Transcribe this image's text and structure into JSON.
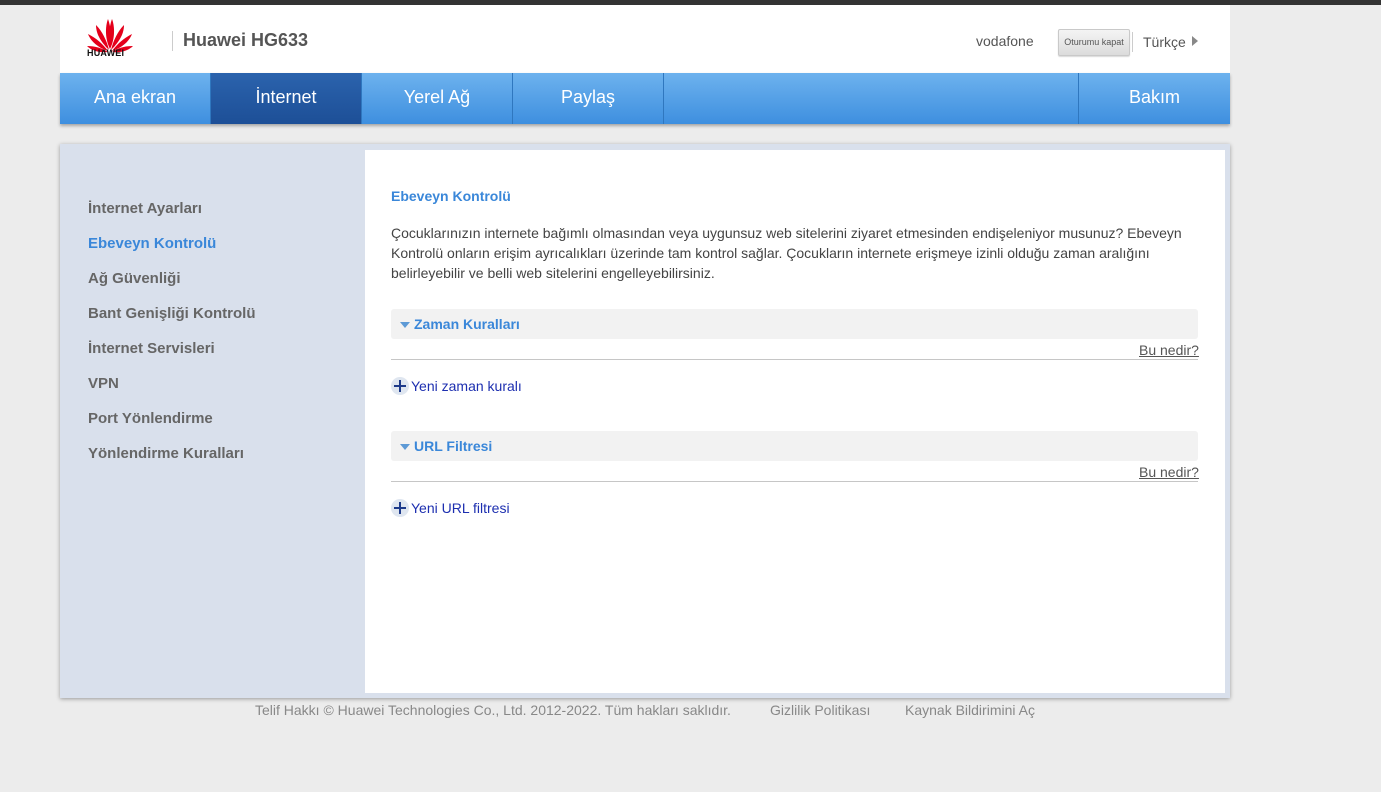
{
  "header": {
    "brand": "HUAWEI",
    "model": "Huawei HG633",
    "user": "vodafone",
    "logout_label": "Oturumu kapat",
    "language": "Türkçe"
  },
  "nav": {
    "items": [
      "Ana ekran",
      "İnternet",
      "Yerel Ağ",
      "Paylaş",
      "Bakım"
    ],
    "active": "İnternet"
  },
  "sidebar": {
    "items": [
      "İnternet Ayarları",
      "Ebeveyn Kontrolü",
      "Ağ Güvenliği",
      "Bant Genişliği Kontrolü",
      "İnternet Servisleri",
      "VPN",
      "Port Yönlendirme",
      "Yönlendirme Kuralları"
    ],
    "active": "Ebeveyn Kontrolü"
  },
  "main": {
    "title": "Ebeveyn Kontrolü",
    "description": "Çocuklarınızın internete bağımlı olmasından veya uygunsuz web sitelerini ziyaret etmesinden endişeleniyor musunuz? Ebeveyn Kontrolü onların erişim ayrıcalıkları üzerinde tam kontrol sağlar. Çocukların internete erişmeye izinli olduğu zaman aralığını belirleyebilir ve belli web sitelerini engelleyebilirsiniz.",
    "sections": [
      {
        "title": "Zaman Kuralları",
        "help": "Bu nedir?",
        "add_label": "Yeni zaman kuralı"
      },
      {
        "title": "URL Filtresi",
        "help": "Bu nedir?",
        "add_label": "Yeni URL filtresi"
      }
    ]
  },
  "footer": {
    "copyright": "Telif Hakkı © Huawei Technologies Co., Ltd. 2012-2022. Tüm hakları saklıdır.",
    "privacy": "Gizlilik Politikası",
    "source": "Kaynak Bildirimini Aç"
  },
  "colors": {
    "nav_blue": "#4a9be6",
    "nav_active": "#24589f",
    "accent": "#3a87d9",
    "logo_red": "#e4001b"
  },
  "icons": {
    "logo": "huawei-petal-logo",
    "language": "caret-right-icon",
    "section_toggle": "caret-down-icon",
    "add": "plus-circle-icon"
  }
}
